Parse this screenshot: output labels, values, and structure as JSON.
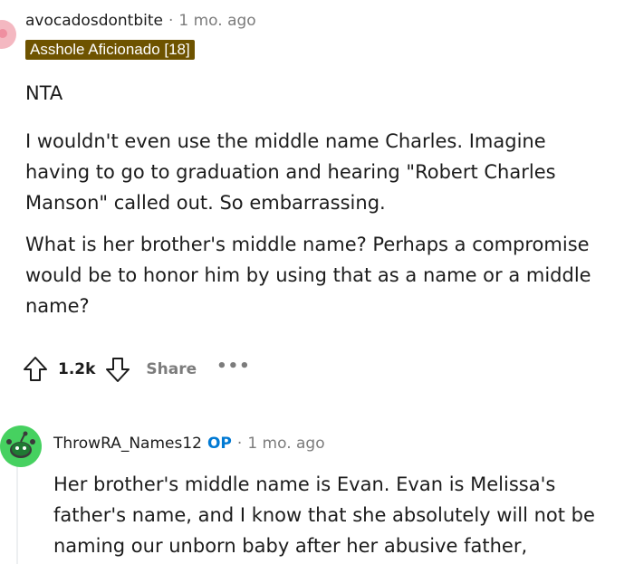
{
  "comment1": {
    "username": "avocadosdontbite",
    "separator": "·",
    "time": "1 mo. ago",
    "flair": "Asshole Aficionado [18]",
    "paragraphs": [
      "NTA",
      "I wouldn't even use the middle name Charles. Imagine having to go to graduation and hearing \"Robert Charles Manson\" called out. So embarrassing.",
      "What is her brother's middle name? Perhaps a compromise would be to honor him by using that as a name or a middle name?"
    ],
    "votes": "1.2k",
    "share_label": "Share",
    "more_label": "•••",
    "icons": {
      "avatar": "user-avatar-icon",
      "upvote": "upvote-arrow-icon",
      "downvote": "downvote-arrow-icon",
      "more": "more-dots-icon"
    }
  },
  "comment2": {
    "username": "ThrowRA_Names12",
    "op_badge": "OP",
    "separator": "·",
    "time": "1 mo. ago",
    "body": "Her brother's middle name is Evan. Evan is Melissa's father's name, and I know that she absolutely will not be naming our unborn baby after her abusive father,",
    "icons": {
      "avatar": "snoo-avatar-icon"
    }
  },
  "colors": {
    "flair_bg": "#6e5300",
    "op_blue": "#0079d3",
    "muted": "#7c7c7c",
    "avatar_green": "#46d160"
  }
}
